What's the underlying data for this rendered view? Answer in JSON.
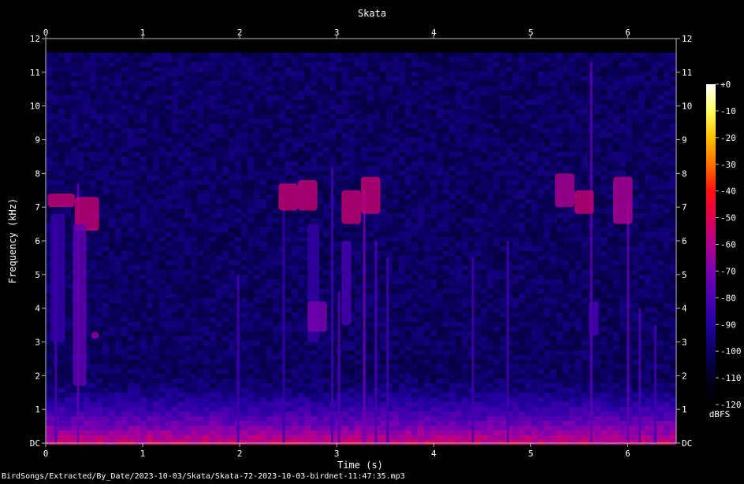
{
  "chart_data": {
    "type": "heatmap",
    "title": "Skata",
    "xlabel": "Time (s)",
    "ylabel": "Frequency (kHz)",
    "xlim": [
      0,
      6.5
    ],
    "ylim": [
      0,
      12
    ],
    "x_ticks": [
      "0",
      "1",
      "2",
      "3",
      "4",
      "5",
      "6"
    ],
    "y_ticks": [
      "DC",
      "1",
      "2",
      "3",
      "4",
      "5",
      "6",
      "7",
      "8",
      "9",
      "10",
      "11",
      "12"
    ],
    "colorbar": {
      "label": "dBFS",
      "range": [
        -120,
        0
      ],
      "ticks": [
        "+0",
        "-10",
        "-20",
        "-30",
        "-40",
        "-50",
        "-60",
        "-70",
        "-80",
        "-90",
        "-100",
        "-110",
        "-120"
      ],
      "colors": [
        "#ffffff",
        "#ffff60",
        "#ffc000",
        "#ff7000",
        "#ff1010",
        "#e00050",
        "#b00090",
        "#7a00b0",
        "#4a00b0",
        "#2200a0",
        "#0a0060",
        "#020020",
        "#000000"
      ]
    },
    "background_level_dbfs": -100,
    "max_freq_khz": 11.6,
    "noise_floor": {
      "top_khz": 2.0,
      "level_dbfs": -55
    },
    "calls": [
      {
        "t0": 0.02,
        "t1": 0.3,
        "f0": 7.0,
        "f1": 7.4,
        "level": -55
      },
      {
        "t0": 0.3,
        "t1": 0.55,
        "f0": 6.3,
        "f1": 7.3,
        "level": -55
      },
      {
        "t0": 0.28,
        "t1": 0.42,
        "f0": 1.7,
        "f1": 6.5,
        "level": -75
      },
      {
        "t0": 0.05,
        "t1": 0.2,
        "f0": 3.0,
        "f1": 6.8,
        "level": -85
      },
      {
        "t0": 0.47,
        "t1": 0.55,
        "f0": 3.1,
        "f1": 3.3,
        "level": -65
      },
      {
        "t0": 2.4,
        "t1": 2.6,
        "f0": 6.9,
        "f1": 7.7,
        "level": -55
      },
      {
        "t0": 2.6,
        "t1": 2.8,
        "f0": 6.9,
        "f1": 7.8,
        "level": -55
      },
      {
        "t0": 2.7,
        "t1": 2.82,
        "f0": 3.0,
        "f1": 6.5,
        "level": -85
      },
      {
        "t0": 3.05,
        "t1": 3.25,
        "f0": 6.5,
        "f1": 7.5,
        "level": -55
      },
      {
        "t0": 3.25,
        "t1": 3.45,
        "f0": 6.8,
        "f1": 7.9,
        "level": -55
      },
      {
        "t0": 3.05,
        "t1": 3.15,
        "f0": 3.5,
        "f1": 6.0,
        "level": -80
      },
      {
        "t0": 2.7,
        "t1": 2.9,
        "f0": 3.3,
        "f1": 4.2,
        "level": -70
      },
      {
        "t0": 5.25,
        "t1": 5.45,
        "f0": 7.0,
        "f1": 8.0,
        "level": -60
      },
      {
        "t0": 5.45,
        "t1": 5.65,
        "f0": 6.8,
        "f1": 7.5,
        "level": -55
      },
      {
        "t0": 5.85,
        "t1": 6.05,
        "f0": 6.5,
        "f1": 7.9,
        "level": -60
      },
      {
        "t0": 5.6,
        "t1": 5.7,
        "f0": 3.2,
        "f1": 4.2,
        "level": -80
      }
    ],
    "clicks": [
      {
        "t": 0.1,
        "top_khz": 6.5,
        "level": -80
      },
      {
        "t": 0.33,
        "top_khz": 7.7,
        "level": -75
      },
      {
        "t": 1.98,
        "top_khz": 5.0,
        "level": -82
      },
      {
        "t": 2.45,
        "top_khz": 7.0,
        "level": -85
      },
      {
        "t": 2.95,
        "top_khz": 8.2,
        "level": -82
      },
      {
        "t": 3.02,
        "top_khz": 4.5,
        "level": -78
      },
      {
        "t": 3.28,
        "top_khz": 7.5,
        "level": -72
      },
      {
        "t": 3.4,
        "top_khz": 6.0,
        "level": -80
      },
      {
        "t": 3.52,
        "top_khz": 5.5,
        "level": -82
      },
      {
        "t": 4.4,
        "top_khz": 5.5,
        "level": -82
      },
      {
        "t": 4.76,
        "top_khz": 6.0,
        "level": -82
      },
      {
        "t": 5.62,
        "top_khz": 11.3,
        "level": -76
      },
      {
        "t": 6.0,
        "top_khz": 7.2,
        "level": -76
      },
      {
        "t": 6.12,
        "top_khz": 4.0,
        "level": -80
      },
      {
        "t": 6.28,
        "top_khz": 3.5,
        "level": -82
      }
    ]
  },
  "footer_path": "BirdSongs/Extracted/By_Date/2023-10-03/Skata/Skata-72-2023-10-03-birdnet-11:47:35.mp3"
}
